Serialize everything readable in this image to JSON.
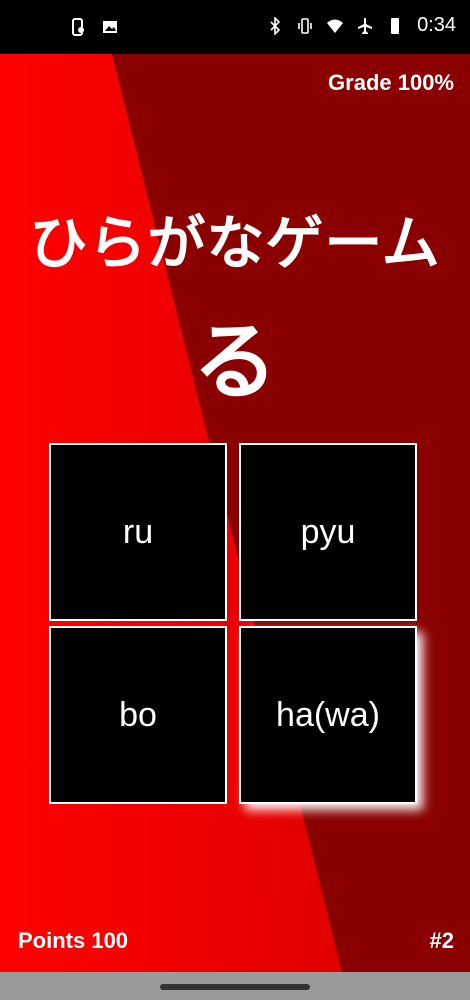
{
  "status_bar": {
    "time": "0:34",
    "left_icons": [
      "phone-settings-icon",
      "image-icon"
    ],
    "right_icons": [
      "bluetooth-icon",
      "vibrate-icon",
      "wifi-icon",
      "airplane-icon",
      "battery-icon"
    ]
  },
  "header": {
    "grade": "Grade 100%"
  },
  "game": {
    "title": "ひらがなゲーム",
    "character": "る",
    "options": [
      "ru",
      "pyu",
      "bo",
      "ha(wa)"
    ]
  },
  "footer": {
    "points": "Points 100",
    "question_number": "#2"
  },
  "colors": {
    "background_dark": "#8a0000",
    "background_bright": "#ff0000",
    "tile": "#000000",
    "text": "#ffffff"
  }
}
